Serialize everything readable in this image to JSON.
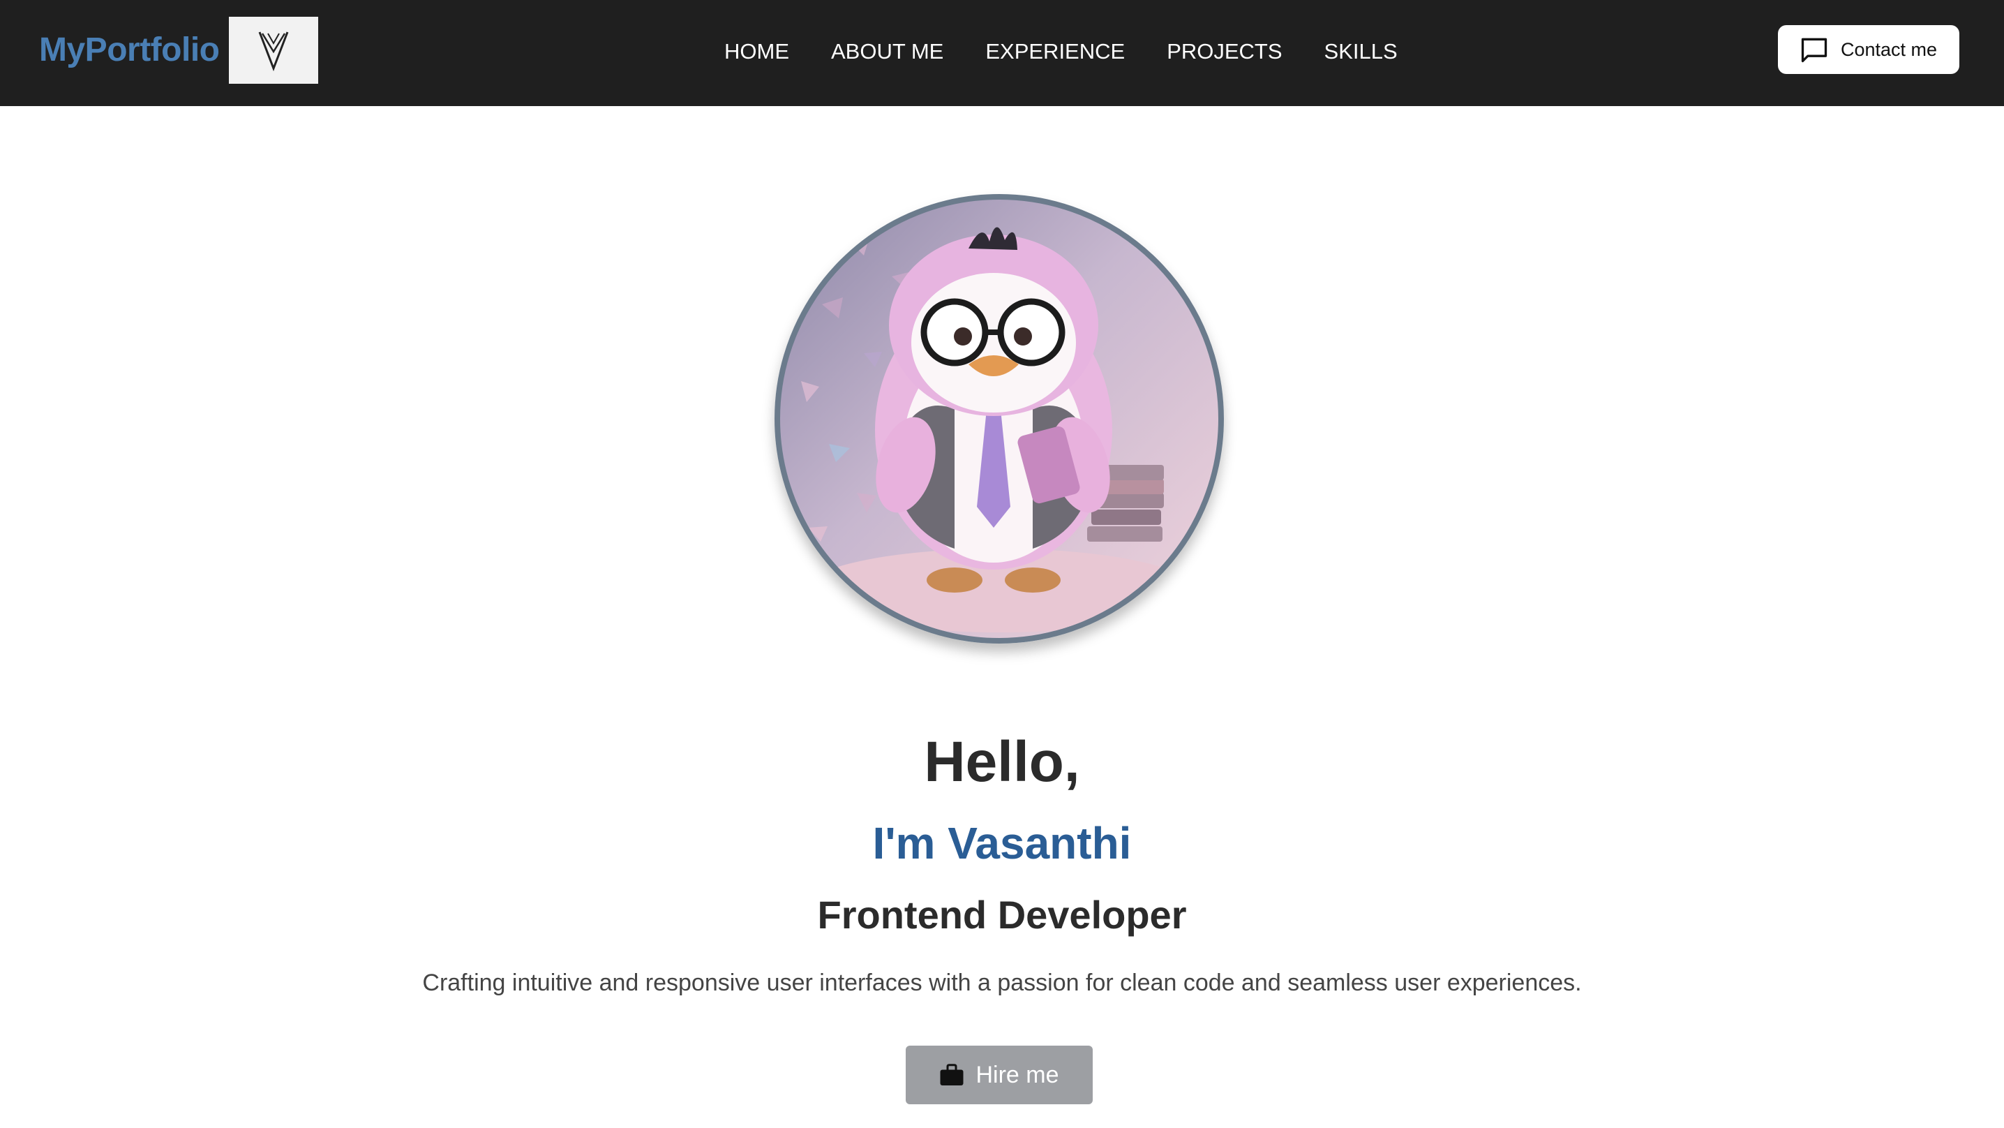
{
  "navbar": {
    "brand": "MyPortfolio",
    "logo_icon": "vm-monogram-logo",
    "links": [
      "HOME",
      "ABOUT ME",
      "EXPERIENCE",
      "PROJECTS",
      "SKILLS"
    ],
    "contact_button": {
      "label": "Contact me",
      "icon": "chat-bubble-icon"
    }
  },
  "hero": {
    "avatar_alt": "penguin-developer-avatar",
    "greeting": "Hello,",
    "name": "I'm Vasanthi",
    "role": "Frontend Developer",
    "tagline": "Crafting intuitive and responsive user interfaces with a passion for clean code and seamless user experiences.",
    "hire_button": {
      "label": "Hire me",
      "icon": "briefcase-icon"
    }
  },
  "colors": {
    "navbar_bg": "#1f1f1f",
    "brand": "#4a7fb5",
    "name_accent": "#2a5d95",
    "heading_text": "#2b2b2b",
    "hire_button_bg": "#9d9fa3"
  }
}
